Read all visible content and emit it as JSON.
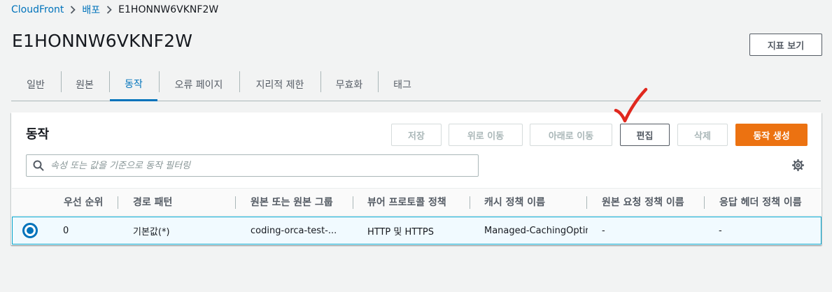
{
  "breadcrumb": {
    "root": "CloudFront",
    "parent": "배포",
    "current": "E1HONNW6VKNF2W"
  },
  "header": {
    "title": "E1HONNW6VKNF2W",
    "view_metrics_label": "지표 보기"
  },
  "tabs": [
    "일반",
    "원본",
    "동작",
    "오류 페이지",
    "지리적 제한",
    "무효화",
    "태그"
  ],
  "active_tab": "동작",
  "behaviors": {
    "title": "동작",
    "buttons": {
      "save": "저장",
      "move_up": "위로 이동",
      "move_down": "아래로 이동",
      "edit": "편집",
      "delete": "삭제",
      "create": "동작 생성"
    },
    "search_placeholder": "속성 또는 값을 기준으로 동작 필터링",
    "columns": [
      "우선 순위",
      "경로 패턴",
      "원본 또는 원본 그룹",
      "뷰어 프로토콜 정책",
      "캐시 정책 이름",
      "원본 요청 정책 이름",
      "응답 헤더 정책 이름"
    ],
    "rows": [
      {
        "priority": "0",
        "path_pattern": "기본값(*)",
        "origin": "coding-orca-test-...",
        "viewer_protocol": "HTTP 및 HTTPS",
        "cache_policy": "Managed-CachingOptimized",
        "origin_request_policy": "-",
        "response_headers_policy": "-",
        "selected": true
      }
    ]
  },
  "colors": {
    "accent": "#0073bb",
    "primary_button": "#ec7211",
    "annotation_check": "#e0281e"
  },
  "icons": {
    "breadcrumb_separator": "chevron-right-icon",
    "search": "search-icon",
    "settings": "gear-icon",
    "annotation": "checkmark-icon"
  }
}
